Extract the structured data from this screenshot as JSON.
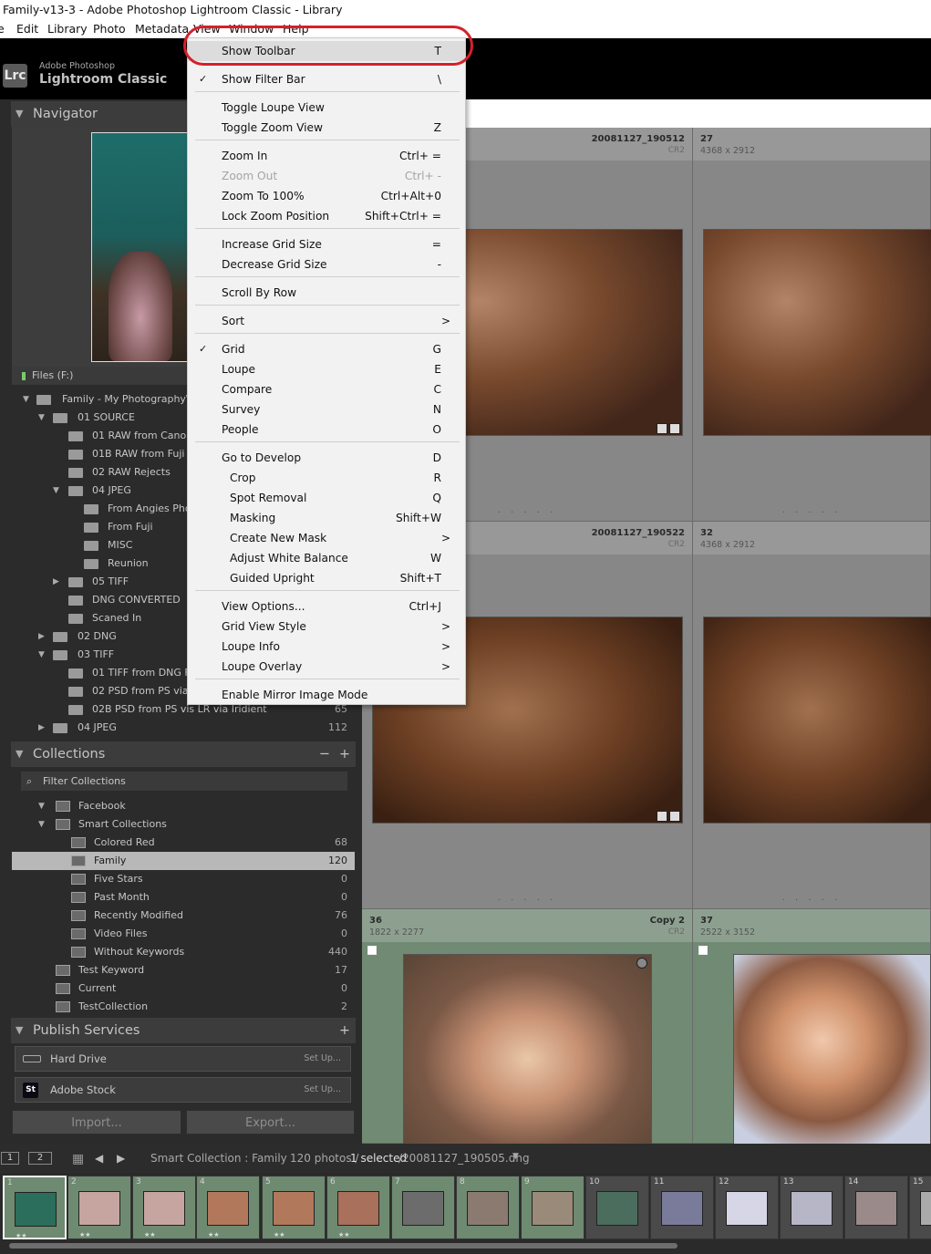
{
  "window": {
    "title": "Family-v13-3 - Adobe Photoshop Lightroom Classic - Library"
  },
  "menubar": [
    "Edit",
    "Library",
    "Photo",
    "Metadata",
    "View",
    "Window",
    "Help"
  ],
  "brand": {
    "small": "Adobe Photoshop",
    "large": "Lightroom Classic",
    "logo": "Lrc"
  },
  "navigator": {
    "label": "Navigator"
  },
  "folders": {
    "volume": "Files (F:)",
    "rows": [
      {
        "label": "Family - My Photography\\Pe",
        "count": ""
      },
      {
        "label": "01 SOURCE",
        "count": ""
      },
      {
        "label": "01 RAW from Canon",
        "count": ""
      },
      {
        "label": "01B RAW from Fuji",
        "count": ""
      },
      {
        "label": "02 RAW Rejects",
        "count": ""
      },
      {
        "label": "04 JPEG",
        "count": ""
      },
      {
        "label": "From Angies Phon",
        "count": ""
      },
      {
        "label": "From Fuji",
        "count": ""
      },
      {
        "label": "MISC",
        "count": ""
      },
      {
        "label": "Reunion",
        "count": ""
      },
      {
        "label": "05 TIFF",
        "count": ""
      },
      {
        "label": "DNG CONVERTED",
        "count": ""
      },
      {
        "label": "Scaned In",
        "count": ""
      },
      {
        "label": "02 DNG",
        "count": ""
      },
      {
        "label": "03 TIFF",
        "count": ""
      },
      {
        "label": "01 TIFF from DNG Fro",
        "count": ""
      },
      {
        "label": "02 PSD from PS via L",
        "count": ""
      },
      {
        "label": "02B PSD from PS vis LR via Iridient",
        "count": "65"
      },
      {
        "label": "04 JPEG",
        "count": "112"
      }
    ]
  },
  "collections": {
    "label": "Collections",
    "minus": "−",
    "plus": "+",
    "filter": "Filter Collections",
    "rows": [
      {
        "label": "Facebook",
        "count": ""
      },
      {
        "label": "Smart Collections",
        "count": ""
      },
      {
        "label": "Colored Red",
        "count": "68"
      },
      {
        "label": "Family",
        "count": "120"
      },
      {
        "label": "Five Stars",
        "count": "0"
      },
      {
        "label": "Past Month",
        "count": "0"
      },
      {
        "label": "Recently Modified",
        "count": "76"
      },
      {
        "label": "Video Files",
        "count": "0"
      },
      {
        "label": "Without Keywords",
        "count": "440"
      },
      {
        "label": "Test Keyword",
        "count": "17"
      },
      {
        "label": "Current",
        "count": "0"
      },
      {
        "label": "TestCollection",
        "count": "2"
      }
    ]
  },
  "publish": {
    "label": "Publish Services",
    "plus": "+",
    "services": [
      {
        "name": "Hard Drive",
        "action": "Set Up..."
      },
      {
        "name": "Adobe Stock",
        "action": "Set Up...",
        "icon": "St"
      }
    ]
  },
  "buttons": {
    "import": "Import...",
    "export": "Export..."
  },
  "grid": {
    "cells": [
      {
        "num": "",
        "dims": "",
        "name": "20081127_190512",
        "ext": "CR2"
      },
      {
        "num": "27",
        "dims": "4368 x 2912",
        "name": "",
        "ext": ""
      },
      {
        "num": "",
        "dims": "",
        "name": "20081127_190522",
        "ext": "CR2"
      },
      {
        "num": "32",
        "dims": "4368 x 2912",
        "name": "",
        "ext": ""
      },
      {
        "num": "36",
        "dims": "1822 x 2277",
        "name": "Copy 2",
        "ext": "CR2"
      },
      {
        "num": "37",
        "dims": "2522 x 3152",
        "name": "",
        "ext": ""
      }
    ],
    "dots": ". . . . ."
  },
  "toolbar": {
    "view1": "1",
    "view2": "2",
    "source": "Smart Collection : Family",
    "count": "120 photos /",
    "selected": "1 selected",
    "file": "/20081127_190505.dng"
  },
  "filmstrip": {
    "frames": [
      "1",
      "2",
      "3",
      "4",
      "5",
      "6",
      "7",
      "8",
      "9",
      "10",
      "11",
      "12",
      "13",
      "14",
      "15"
    ],
    "stars": "★★"
  },
  "view_menu": {
    "items": [
      {
        "label": "Show Toolbar",
        "shortcut": "T"
      },
      {
        "label": "Show Filter Bar",
        "shortcut": "\\",
        "check": "✓"
      },
      {
        "label": "Toggle Loupe View",
        "shortcut": ""
      },
      {
        "label": "Toggle Zoom View",
        "shortcut": "Z"
      },
      {
        "label": "Zoom In",
        "shortcut": "Ctrl+ ="
      },
      {
        "label": "Zoom Out",
        "shortcut": "Ctrl+ -"
      },
      {
        "label": "Zoom To 100%",
        "shortcut": "Ctrl+Alt+0"
      },
      {
        "label": "Lock Zoom Position",
        "shortcut": "Shift+Ctrl+ ="
      },
      {
        "label": "Increase Grid Size",
        "shortcut": "="
      },
      {
        "label": "Decrease Grid Size",
        "shortcut": "-"
      },
      {
        "label": "Scroll By Row",
        "shortcut": ""
      },
      {
        "label": "Sort",
        "shortcut": ""
      },
      {
        "label": "Grid",
        "shortcut": "G",
        "check": "✓"
      },
      {
        "label": "Loupe",
        "shortcut": "E"
      },
      {
        "label": "Compare",
        "shortcut": "C"
      },
      {
        "label": "Survey",
        "shortcut": "N"
      },
      {
        "label": "People",
        "shortcut": "O"
      },
      {
        "label": "Go to Develop",
        "shortcut": "D"
      },
      {
        "label": "Crop",
        "shortcut": "R"
      },
      {
        "label": "Spot Removal",
        "shortcut": "Q"
      },
      {
        "label": "Masking",
        "shortcut": "Shift+W"
      },
      {
        "label": "Create New Mask",
        "shortcut": ""
      },
      {
        "label": "Adjust White Balance",
        "shortcut": "W"
      },
      {
        "label": "Guided Upright",
        "shortcut": "Shift+T"
      },
      {
        "label": "View Options...",
        "shortcut": "Ctrl+J"
      },
      {
        "label": "Grid View Style",
        "shortcut": ""
      },
      {
        "label": "Loupe Info",
        "shortcut": ""
      },
      {
        "label": "Loupe Overlay",
        "shortcut": ""
      },
      {
        "label": "Enable Mirror Image Mode",
        "shortcut": ""
      }
    ],
    "submenu_arrow": ">"
  }
}
